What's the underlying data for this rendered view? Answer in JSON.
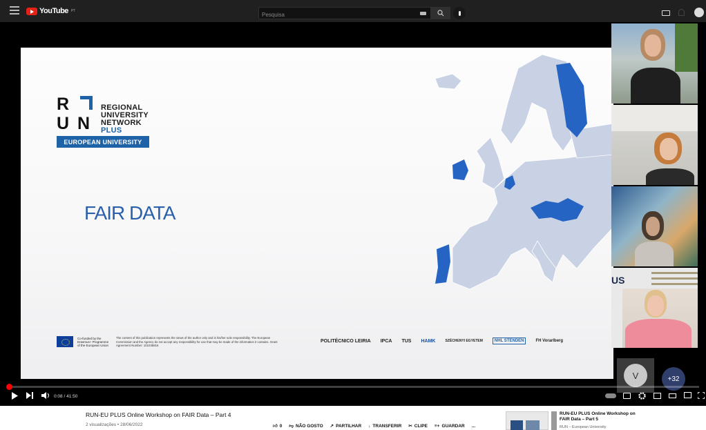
{
  "topbar": {
    "logo_text": "YouTube",
    "logo_region": "PT",
    "search_placeholder": "Pesquisa"
  },
  "slide": {
    "logo_letters": [
      "R",
      "U",
      "N"
    ],
    "logo_lines": [
      "REGIONAL",
      "UNIVERSITY",
      "NETWORK",
      "PLUS"
    ],
    "eu_bar": "EUROPEAN UNIVERSITY",
    "heading": "FAIR DATA",
    "cofunded": [
      "Co-funded by the",
      "Erasmus+ Programme",
      "of the European Union"
    ],
    "disclaimer": "The content of this publication represents the views of the author only and is his/her sole responsibility. The European Commission and the Agency do not accept any responsibility for use that may be made of the information it contains. Grant Agreement Number: 101035816",
    "partners": [
      "POLITÉCNICO LEIRIA",
      "IPCA",
      "TUS",
      "HAMK",
      "SZÉCHENYI EGYETEM",
      "NHL STENDEN",
      "FH Vorarlberg"
    ],
    "highlight_color": "#2664c4",
    "map_base_color": "#c9d2e4"
  },
  "webcam_overlay": {
    "partial_text": "US",
    "tile_initial": "V",
    "extra_participants": "+32"
  },
  "player": {
    "time": "0:08 / 41:50",
    "progress_fraction": 0.003
  },
  "video": {
    "title": "RUN-EU PLUS Online Workshop on FAIR Data – Part 4",
    "meta": "2 visualizações • 28/06/2022",
    "like_count": "0",
    "dislike_label": "NÃO GOSTO",
    "share_label": "PARTILHAR",
    "download_label": "TRANSFERIR",
    "clip_label": "CLIPE",
    "save_label": "GUARDAR",
    "more_label": "..."
  },
  "recommendation": {
    "title": "RUN-EU PLUS Online Workshop on FAIR Data – Part 5",
    "channel": "RUN – European University"
  }
}
